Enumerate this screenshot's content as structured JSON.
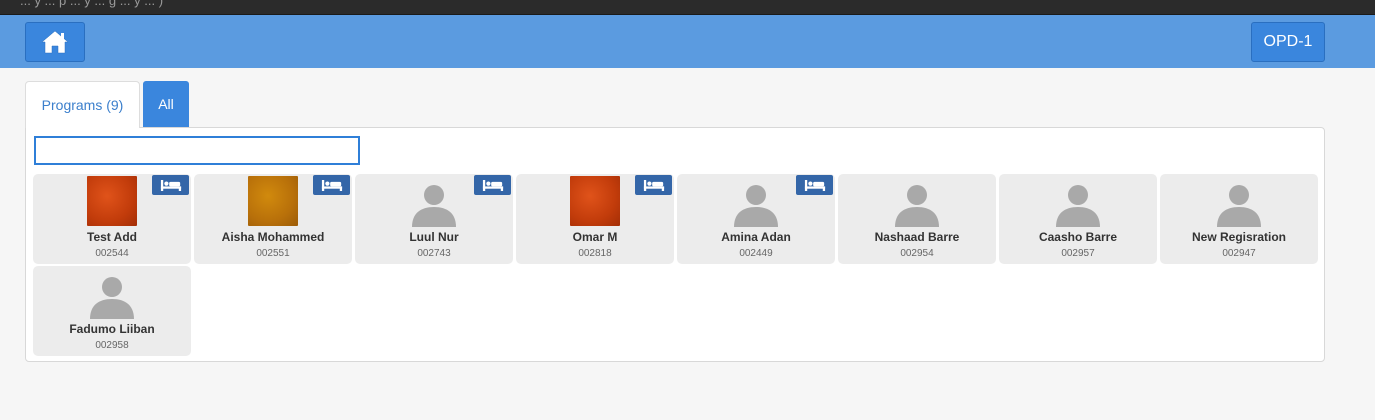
{
  "topbar": {
    "title": "... y ... p ... y ... g ... y ... )"
  },
  "header": {
    "home_icon": "home-icon",
    "location_label": "OPD-1"
  },
  "tabs": [
    {
      "label": "Programs (9)",
      "active": true
    },
    {
      "label": "All",
      "active": false
    }
  ],
  "search": {
    "value": "",
    "placeholder": ""
  },
  "colors": {
    "header": "#5b9be0",
    "button": "#3a86dd",
    "badge": "#3466a8",
    "card": "#ececec"
  },
  "patients": [
    {
      "name": "Test Add",
      "id": "002544",
      "photo": "red",
      "admitted": true
    },
    {
      "name": "Aisha Mohammed",
      "id": "002551",
      "photo": "amber",
      "admitted": true
    },
    {
      "name": "Luul Nur",
      "id": "002743",
      "photo": "none",
      "admitted": true
    },
    {
      "name": "Omar M",
      "id": "002818",
      "photo": "red",
      "admitted": true
    },
    {
      "name": "Amina Adan",
      "id": "002449",
      "photo": "none",
      "admitted": true
    },
    {
      "name": "Nashaad Barre",
      "id": "002954",
      "photo": "none",
      "admitted": false
    },
    {
      "name": "Caasho Barre",
      "id": "002957",
      "photo": "none",
      "admitted": false
    },
    {
      "name": "New Regisration",
      "id": "002947",
      "photo": "none",
      "admitted": false
    },
    {
      "name": "Fadumo Liiban",
      "id": "002958",
      "photo": "none",
      "admitted": false
    }
  ]
}
